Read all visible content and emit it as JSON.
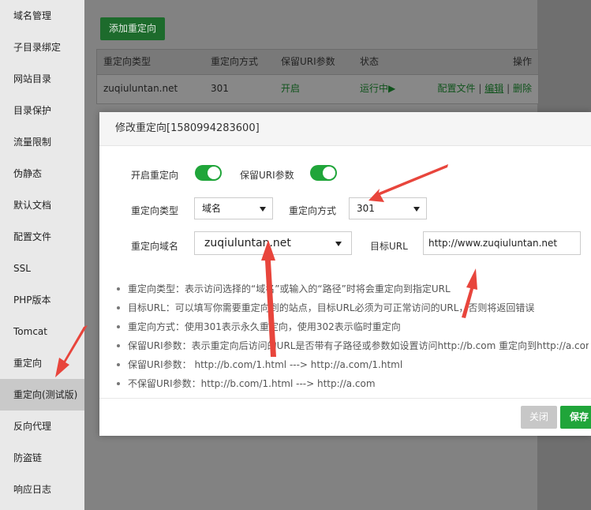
{
  "sidebar": {
    "items": [
      {
        "label": "域名管理"
      },
      {
        "label": "子目录绑定"
      },
      {
        "label": "网站目录"
      },
      {
        "label": "目录保护"
      },
      {
        "label": "流量限制"
      },
      {
        "label": "伪静态"
      },
      {
        "label": "默认文档"
      },
      {
        "label": "配置文件"
      },
      {
        "label": "SSL"
      },
      {
        "label": "PHP版本"
      },
      {
        "label": "Tomcat"
      },
      {
        "label": "重定向"
      },
      {
        "label": "重定向(测试版)"
      },
      {
        "label": "反向代理"
      },
      {
        "label": "防盗链"
      },
      {
        "label": "响应日志"
      }
    ],
    "active_index": 12
  },
  "toolbar": {
    "add_label": "添加重定向"
  },
  "table": {
    "headers": [
      "重定向类型",
      "重定向方式",
      "保留URI参数",
      "状态",
      "操作"
    ],
    "row": {
      "type": "zuqiuluntan.net",
      "method": "301",
      "keep_uri": "开启",
      "status": "运行中",
      "status_icon": "▶",
      "op_config": "配置文件",
      "op_edit": "编辑",
      "op_delete": "删除",
      "sep": "|"
    }
  },
  "modal": {
    "title": "修改重定向[1580994283600]",
    "enable_label": "开启重定向",
    "keep_uri_label": "保留URI参数",
    "type_label": "重定向类型",
    "type_value": "域名",
    "method_label": "重定向方式",
    "method_value": "301",
    "domain_label": "重定向域名",
    "domain_value": "zuqiuluntan.net",
    "target_label": "目标URL",
    "target_value": "http://www.zuqiuluntan.net",
    "help": [
      "重定向类型：表示访问选择的“域名”或输入的“路径”时将会重定向到指定URL",
      "目标URL：可以填写你需要重定向到的站点，目标URL必须为可正常访问的URL，否则将返回错误",
      "重定向方式：使用301表示永久重定向，使用302表示临时重定向",
      "保留URI参数：表示重定向后访问的URL是否带有子路径或参数如设置访问http://b.com 重定向到http://a.com",
      "保留URI参数：  http://b.com/1.html ---> http://a.com/1.html",
      "不保留URI参数：http://b.com/1.html ---> http://a.com"
    ],
    "close_label": "关闭",
    "save_label": "保存"
  },
  "colors": {
    "accent": "#20a53a",
    "annotation_arrow": "#e8453c"
  }
}
